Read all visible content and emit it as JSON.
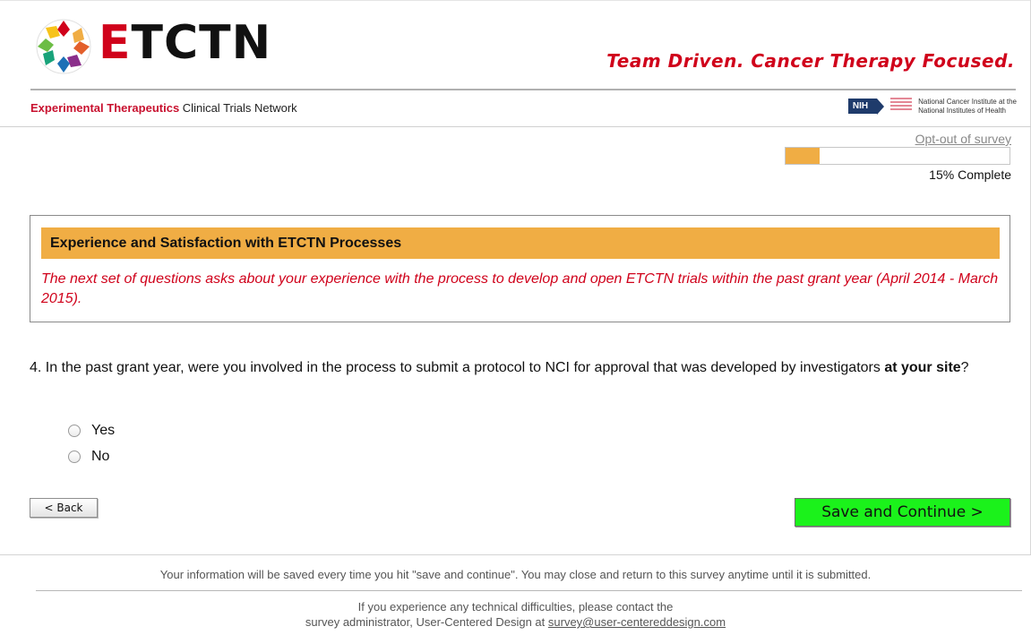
{
  "header": {
    "logo_text": "ETCTN",
    "logo_first_letter": "E",
    "logo_rest": "TCTN",
    "tagline": "Team Driven. Cancer Therapy Focused.",
    "network_bold": "Experimental Therapeutics",
    "network_rest": "Clinical Trials Network",
    "nih_badge": "NIH",
    "nci_mark": "NATIONAL CANCER INSTITUTE",
    "nci_line1": "National Cancer Institute at the",
    "nci_line2": "National Institutes of Health"
  },
  "survey": {
    "optout_label": "Opt-out of survey",
    "progress_percent": 15,
    "progress_label": "15% Complete"
  },
  "section": {
    "title": "Experience and Satisfaction with ETCTN Processes",
    "description": "The next set of questions asks about your experience with the process to develop and open ETCTN trials within the past grant year (April 2014 - March 2015)."
  },
  "question": {
    "number": "4.",
    "text_before": "In the past grant year, were you involved in the process to submit a protocol to NCI for approval that was developed by investigators",
    "text_bold": "at your site",
    "text_after": "?",
    "options": [
      "Yes",
      "No"
    ]
  },
  "buttons": {
    "back_label": "< Back",
    "save_label": "Save and Continue >"
  },
  "footer": {
    "save_note": "Your information will be saved every time you hit \"save and continue\". You may close and return to this survey anytime until it is submitted.",
    "contact_line1": "If you experience any technical difficulties, please contact the",
    "contact_line2": "survey administrator, User-Centered Design at",
    "contact_email": "survey@user-centereddesign.com"
  },
  "colors": {
    "brand_red": "#d0021b",
    "section_orange": "#f0ad44",
    "save_green": "#1bf21b",
    "nih_blue": "#1f3b6b"
  },
  "icons": [
    "etctn-logo-icon",
    "nih-logo-icon",
    "nci-logo-icon",
    "radio-icon"
  ]
}
